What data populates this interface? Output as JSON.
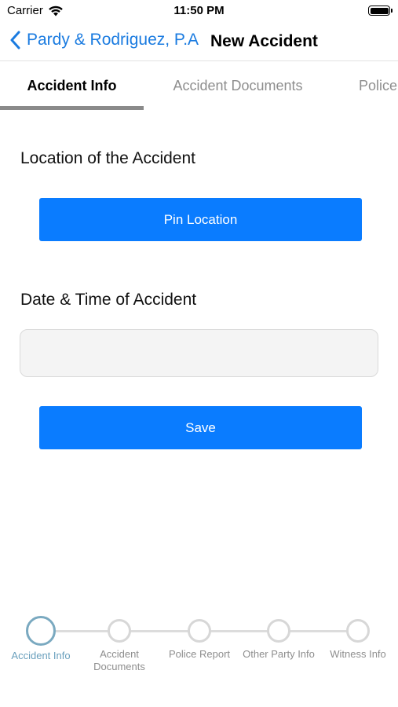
{
  "status_bar": {
    "carrier": "Carrier",
    "time": "11:50 PM",
    "icons": [
      "wifi-icon",
      "battery-icon"
    ]
  },
  "nav": {
    "back_label": "Pardy & Rodriguez, P.A",
    "title": "New Accident",
    "accent_color": "#1a7be0"
  },
  "tabs": [
    {
      "label": "Accident Info",
      "selected": true
    },
    {
      "label": "Accident Documents",
      "selected": false
    },
    {
      "label": "Police",
      "selected": false
    }
  ],
  "form": {
    "location_label": "Location of the Accident",
    "pin_button_label": "Pin Location",
    "date_label": "Date & Time of Accident",
    "date_value": "",
    "date_placeholder": "",
    "save_button_label": "Save",
    "button_color": "#0a7cff"
  },
  "stepper": {
    "steps": [
      {
        "label": "Accident Info",
        "active": true
      },
      {
        "label": "Accident Documents",
        "active": false
      },
      {
        "label": "Police Report",
        "active": false
      },
      {
        "label": "Other Party Info",
        "active": false
      },
      {
        "label": "Witness Info",
        "active": false
      }
    ],
    "active_color": "#6aa0bd"
  }
}
